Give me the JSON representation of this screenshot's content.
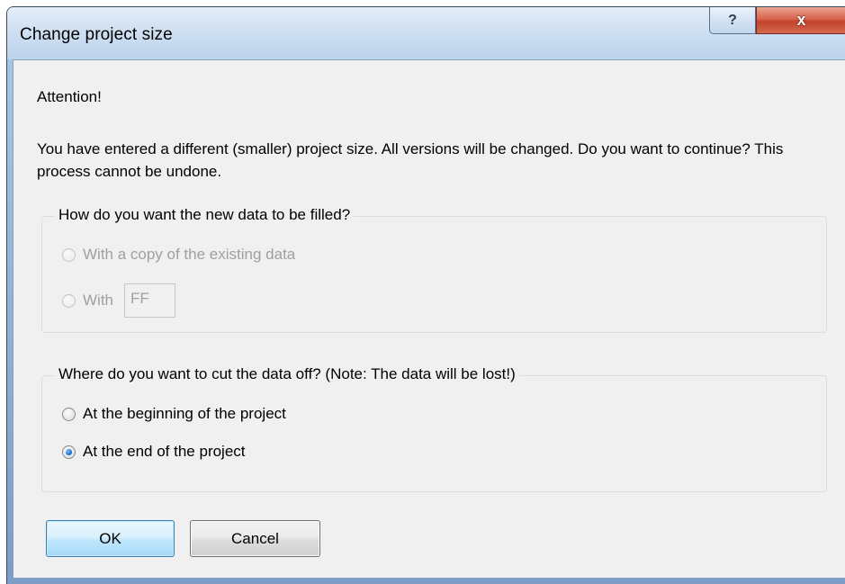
{
  "window": {
    "title": "Change project size",
    "help_label": "?",
    "close_label": "x"
  },
  "dialog": {
    "attention": "Attention!",
    "message": "You have entered a different (smaller) project size. All versions will be changed. Do you want to continue? This process cannot be undone.",
    "fill_group": {
      "legend": "How do you want the new data to be filled?",
      "option_copy": "With a copy of the existing data",
      "option_with": "With",
      "with_value": "FF",
      "enabled": false
    },
    "cut_group": {
      "legend": "Where do you want to cut the data off? (Note: The data will be lost!)",
      "option_beginning": "At the beginning of the project",
      "option_end": "At the end of the project",
      "selected": "At the end of the project"
    },
    "buttons": {
      "ok": "OK",
      "cancel": "Cancel"
    }
  }
}
